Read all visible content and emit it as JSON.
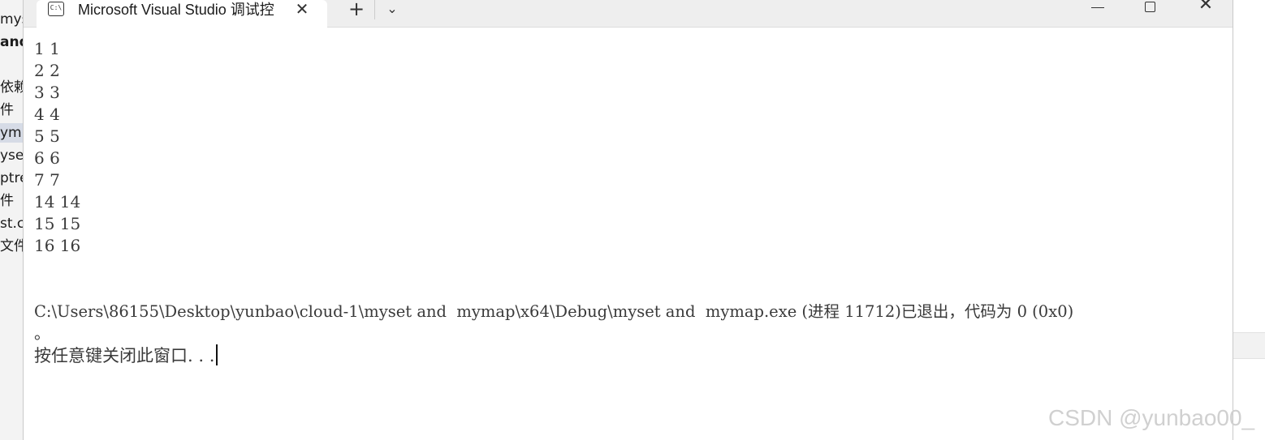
{
  "side_panel": {
    "items": [
      {
        "text": "myse",
        "style": "normal"
      },
      {
        "text": "and",
        "style": "bold"
      },
      {
        "text": "",
        "style": "normal"
      },
      {
        "text": "依赖",
        "style": "normal"
      },
      {
        "text": "件",
        "style": "normal"
      },
      {
        "text": "ymi",
        "style": "selected"
      },
      {
        "text": "yse",
        "style": "normal"
      },
      {
        "text": "ptre",
        "style": "normal"
      },
      {
        "text": "件",
        "style": "normal"
      },
      {
        "text": "st.c",
        "style": "normal"
      },
      {
        "text": "文件",
        "style": "normal"
      }
    ]
  },
  "window": {
    "tab_title": "Microsoft Visual Studio 调试控",
    "tab_icon_text": "C:\\",
    "close_tab_glyph": "✕",
    "new_tab_glyph": "+",
    "dropdown_glyph": "⌄",
    "close_window_glyph": "✕"
  },
  "console": {
    "lines": [
      "1 1",
      "2 2",
      "3 3",
      "4 4",
      "5 5",
      "6 6",
      "7 7",
      "14 14",
      "15 15",
      "16 16"
    ],
    "exit_message": "C:\\Users\\86155\\Desktop\\yunbao\\cloud-1\\myset and  mymap\\x64\\Debug\\myset and  mymap.exe (进程 11712)已退出，代码为 0 (0x0)",
    "exit_message_tail": "。",
    "prompt": "按任意键关闭此窗口. . ."
  },
  "watermark": "CSDN @yunbao00_"
}
